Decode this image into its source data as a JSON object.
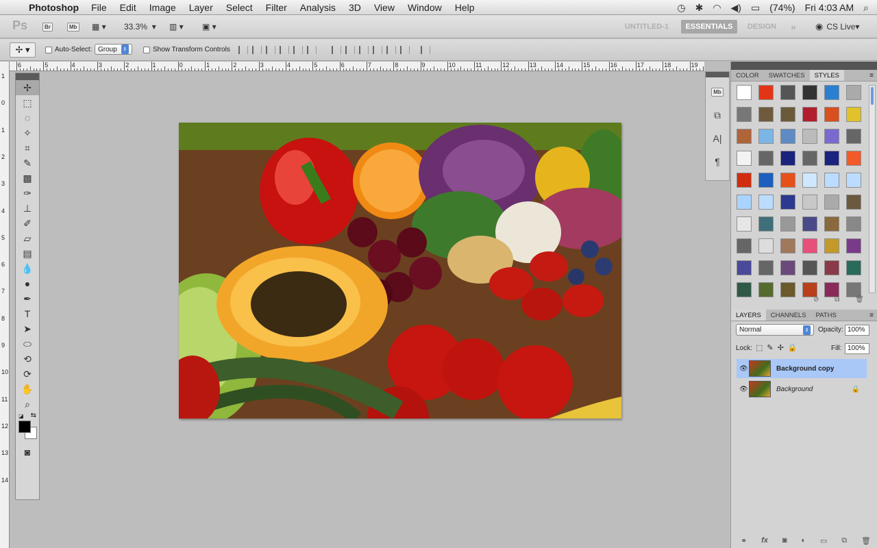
{
  "menubar": {
    "app_name": "Photoshop",
    "menus": [
      "File",
      "Edit",
      "Image",
      "Layer",
      "Select",
      "Filter",
      "Analysis",
      "3D",
      "View",
      "Window",
      "Help"
    ],
    "battery": "(74%)",
    "clock": "Fri 4:03 AM"
  },
  "appbar": {
    "ps_logo": "Ps",
    "br_label": "Br",
    "mb_label": "Mb",
    "zoom": "33.3%",
    "workspaces": [
      "UNTITLED-1",
      "ESSENTIALS",
      "DESIGN"
    ],
    "more_label": "»",
    "cs_live": "CS Live"
  },
  "options": {
    "auto_select_label": "Auto-Select:",
    "auto_select_value": "Group",
    "show_transform_label": "Show Transform Controls"
  },
  "ruler": {
    "labels": [
      "6",
      "5",
      "4",
      "3",
      "2",
      "1",
      "0",
      "1",
      "2",
      "3",
      "4",
      "5",
      "6",
      "7",
      "8",
      "9",
      "10",
      "11",
      "12",
      "13",
      "14",
      "15",
      "16",
      "17",
      "18",
      "19"
    ]
  },
  "vruler": {
    "labels": [
      "1",
      "0",
      "1",
      "2",
      "3",
      "4",
      "5",
      "6",
      "7",
      "8",
      "9",
      "10",
      "11",
      "12",
      "13",
      "14"
    ]
  },
  "styles_panel": {
    "tabs": [
      "COLOR",
      "SWATCHES",
      "STYLES"
    ],
    "active_tab": "STYLES"
  },
  "layers_panel": {
    "tabs": [
      "LAYERS",
      "CHANNELS",
      "PATHS"
    ],
    "active_tab": "LAYERS",
    "blend_mode": "Normal",
    "opacity_label": "Opacity:",
    "opacity_value": "100%",
    "lock_label": "Lock:",
    "fill_label": "Fill:",
    "fill_value": "100%",
    "layers": [
      {
        "name": "Background copy",
        "selected": true
      },
      {
        "name": "Background",
        "selected": false
      }
    ]
  }
}
